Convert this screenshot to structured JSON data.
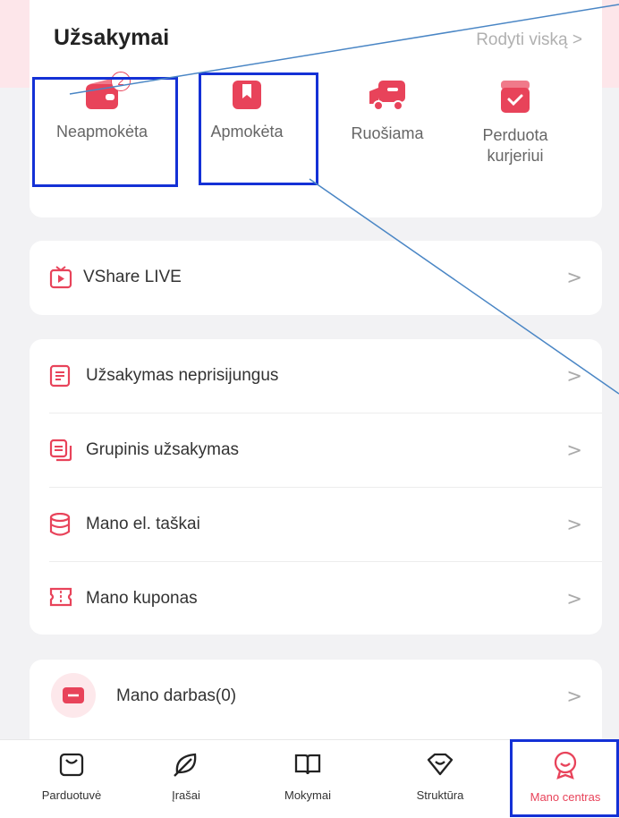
{
  "orders": {
    "title": "Užsakymai",
    "show_all": "Rodyti viską >",
    "items": [
      {
        "label": "Neapmokėta",
        "badge": "2",
        "icon": "wallet-icon"
      },
      {
        "label": "Apmokėta",
        "icon": "paid-bookmark-icon"
      },
      {
        "label": "Ruošiama",
        "icon": "truck-icon"
      },
      {
        "label": "Perduota kurjeriui",
        "icon": "package-icon"
      }
    ]
  },
  "live": {
    "label": "VShare LIVE",
    "icon": "tv-play-icon"
  },
  "menu": [
    {
      "label": "Užsakymas neprisijungus",
      "icon": "document-icon"
    },
    {
      "label": "Grupinis užsakymas",
      "icon": "group-order-icon"
    },
    {
      "label": "Mano el. taškai",
      "icon": "database-icon"
    },
    {
      "label": "Mano kuponas",
      "icon": "coupon-icon"
    }
  ],
  "work": {
    "label": "Mano darbas(0)",
    "icon": "briefcase-icon"
  },
  "chevron": ">",
  "nav": [
    {
      "label": "Parduotuvė",
      "icon": "shopping-bag-icon"
    },
    {
      "label": "Įrašai",
      "icon": "leaf-icon"
    },
    {
      "label": "Mokymai",
      "icon": "book-icon"
    },
    {
      "label": "Struktūra",
      "icon": "heart-diamond-icon"
    },
    {
      "label": "Mano centras",
      "icon": "badge-person-icon",
      "active": true
    }
  ],
  "colors": {
    "accent": "#e8435a",
    "highlight": "#1431d6",
    "callout_line": "#4a86c5"
  }
}
